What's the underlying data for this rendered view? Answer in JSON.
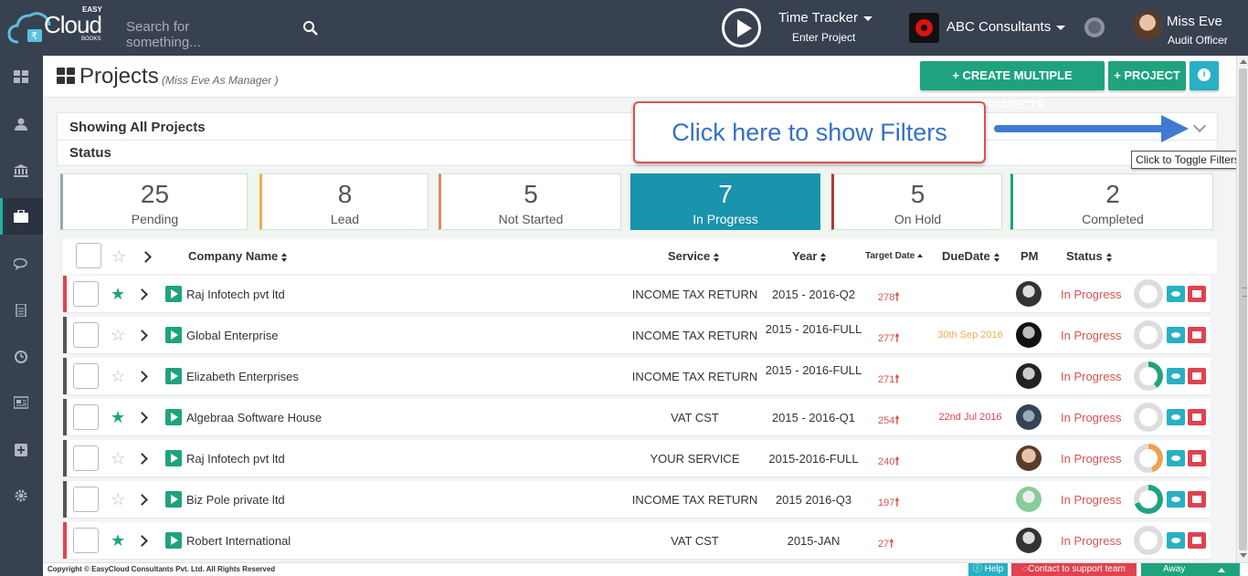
{
  "header": {
    "logo_text": "Cloud",
    "logo_easy": "EASY",
    "logo_books": "BOOKS",
    "search_placeholder": "Search for something...",
    "time_tracker_title": "Time Tracker",
    "time_tracker_sub": "Enter Project",
    "company": "ABC Consultants",
    "user_name": "Miss Eve",
    "user_role": "Audit Officer"
  },
  "sidebar": {
    "items": [
      {
        "icon": "dashboard-icon"
      },
      {
        "icon": "user-icon"
      },
      {
        "icon": "bank-icon"
      },
      {
        "icon": "briefcase-icon",
        "active": true
      },
      {
        "icon": "chat-icon"
      },
      {
        "icon": "document-icon"
      },
      {
        "icon": "clock-icon"
      },
      {
        "icon": "newspaper-icon"
      },
      {
        "icon": "plus-square-icon"
      },
      {
        "icon": "gear-icon"
      }
    ]
  },
  "page": {
    "title": "Projects",
    "subtitle": "(Miss Eve As Manager )",
    "btn_create_multiple": "+ CREATE MULTIPLE PROJECTS",
    "btn_project": "+ PROJECT",
    "filter_title": "Showing All Projects",
    "status_title": "Status",
    "callout": "Click here to show Filters",
    "tooltip": "Click to Toggle Filters"
  },
  "stats": [
    {
      "count": "25",
      "label": "Pending",
      "color": "#9aa5b1"
    },
    {
      "count": "8",
      "label": "Lead",
      "color": "#f0ad4e"
    },
    {
      "count": "5",
      "label": "Not Started",
      "color": "#e8846f"
    },
    {
      "count": "7",
      "label": "In Progress",
      "color": "#1a93ad",
      "active": true
    },
    {
      "count": "5",
      "label": "On Hold",
      "color": "#b03a3a"
    },
    {
      "count": "2",
      "label": "Completed",
      "color": "#1fa37e"
    }
  ],
  "table": {
    "columns": {
      "company": "Company Name",
      "service": "Service",
      "year": "Year",
      "target": "Target Date",
      "due": "DueDate",
      "pm": "PM",
      "status": "Status"
    },
    "rows": [
      {
        "company": "Raj Infotech pvt ltd",
        "service": "INCOME TAX RETURN",
        "year": "2015 - 2016-Q2",
        "target": "278",
        "due": "",
        "status": "In Progress",
        "starred": true,
        "accent": "#e0424f",
        "progress": 0
      },
      {
        "company": "Global Enterprise",
        "service": "INCOME TAX RETURN",
        "year": "2015 - 2016-FULL",
        "target": "277",
        "due": "30th Sep 2016",
        "due_color": "#f0ad4e",
        "status": "In Progress",
        "starred": false,
        "accent": "#555555",
        "progress": 0
      },
      {
        "company": "Elizabeth Enterprises",
        "service": "INCOME TAX RETURN",
        "year": "2015 - 2016-FULL",
        "target": "271",
        "due": "",
        "status": "In Progress",
        "starred": false,
        "accent": "#555555",
        "progress": 0.4
      },
      {
        "company": "Algebraa Software House",
        "service": "VAT CST",
        "year": "2015 - 2016-Q1",
        "target": "254",
        "due": "22nd Jul 2016",
        "due_color": "#e0424f",
        "status": "In Progress",
        "starred": true,
        "accent": "#555555",
        "progress": 0
      },
      {
        "company": "Raj Infotech pvt ltd",
        "service": "YOUR SERVICE",
        "year": "2015-2016-FULL",
        "target": "240",
        "due": "",
        "status": "In Progress",
        "starred": false,
        "accent": "#555555",
        "progress": 0.45
      },
      {
        "company": "Biz Pole private ltd",
        "service": "INCOME TAX RETURN",
        "year": "2015 2016-Q3",
        "target": "197",
        "due": "",
        "status": "In Progress",
        "starred": false,
        "accent": "#555555",
        "progress": 0.7
      },
      {
        "company": "Robert International",
        "service": "VAT CST",
        "year": "2015-JAN",
        "target": "27",
        "due": "",
        "status": "In Progress",
        "starred": true,
        "accent": "#e0424f",
        "progress": 0
      }
    ]
  },
  "footer": {
    "copyright": "Copyright © EasyCloud Consultants Pvt. Ltd. All Rights Reserved",
    "help": "Help",
    "support": "Contact to support team",
    "away": "Away"
  }
}
